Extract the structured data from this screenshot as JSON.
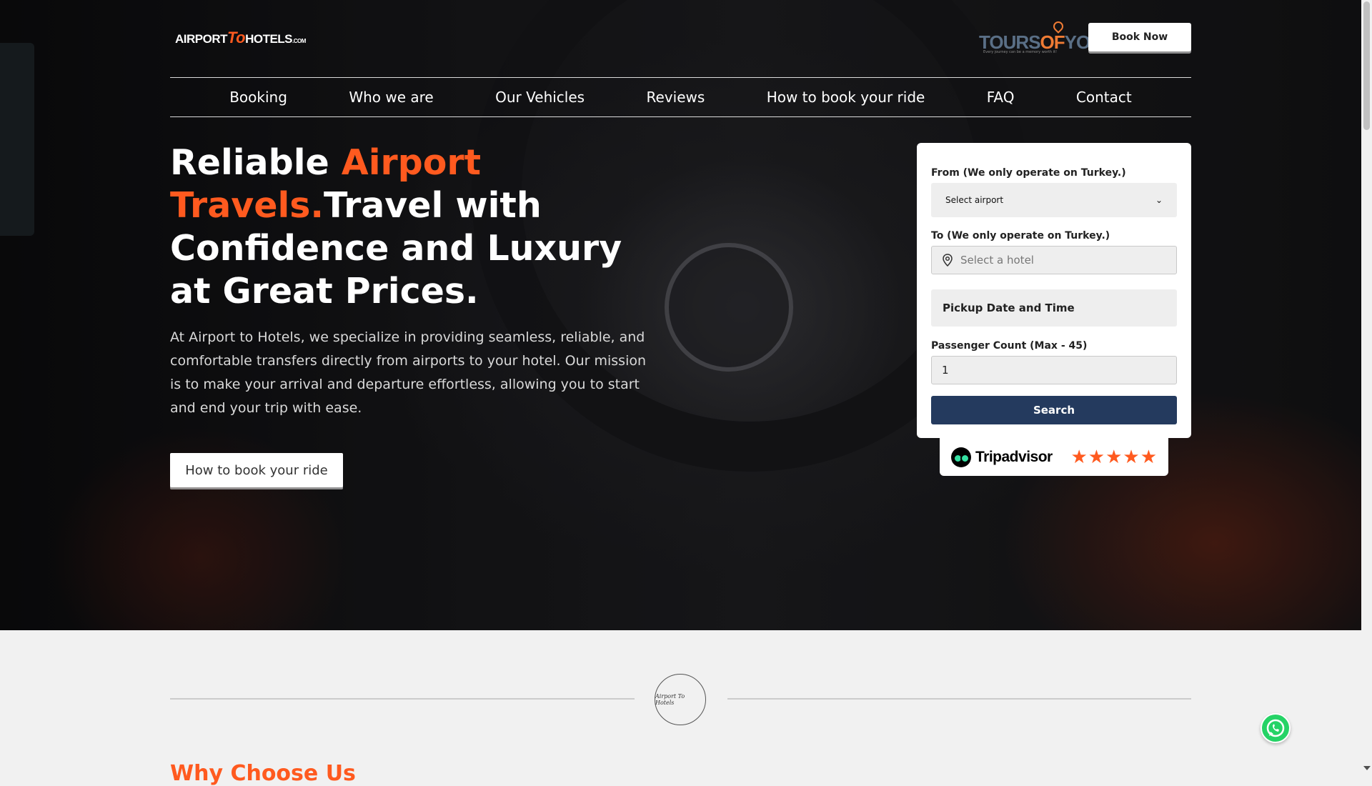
{
  "header": {
    "logo_main": "AIRPORT",
    "logo_to": "To",
    "logo_tail": "HOTELS",
    "logo_com": ".COM",
    "partner_brand_a": "TOURS",
    "partner_brand_b": "OF",
    "partner_brand_c": "YOU",
    "partner_tagline": "Every journey can be a memory worth it!",
    "book_now": "Book Now"
  },
  "nav": {
    "items": [
      "Booking",
      "Who we are",
      "Our Vehicles",
      "Reviews",
      "How to book your ride",
      "FAQ",
      "Contact"
    ]
  },
  "hero": {
    "headline_part1": "Reliable ",
    "headline_accent": "Airport Travels.",
    "headline_part2": "Travel with Confidence and Luxury at Great Prices.",
    "description": "At Airport to Hotels, we specialize in providing seamless, reliable, and comfortable transfers directly from airports to your hotel. Our mission is to make your arrival and departure effortless, allowing you to start and end your trip with ease.",
    "cta": "How to book your ride"
  },
  "booking_form": {
    "from_label": "From (We only operate on Turkey.)",
    "from_value": "Select airport",
    "to_label": "To (We only operate on Turkey.)",
    "to_placeholder": "Select a hotel",
    "pickup_label": "Pickup Date and Time",
    "passenger_label": "Passenger Count (Max - 45)",
    "passenger_value": "1",
    "search": "Search"
  },
  "tripadvisor": {
    "brand": "Tripadvisor",
    "rating": 5
  },
  "section2": {
    "heading": "Why Choose Us",
    "badge_text": "Airport To Hotels"
  },
  "colors": {
    "accent": "#ff5a1f",
    "search_button": "#243a5e",
    "whatsapp": "#25d366"
  },
  "icons": {
    "select_chevron": "chevron-down-icon",
    "hotel_field": "map-pin-icon",
    "star": "star-icon",
    "whatsapp": "whatsapp-icon"
  }
}
